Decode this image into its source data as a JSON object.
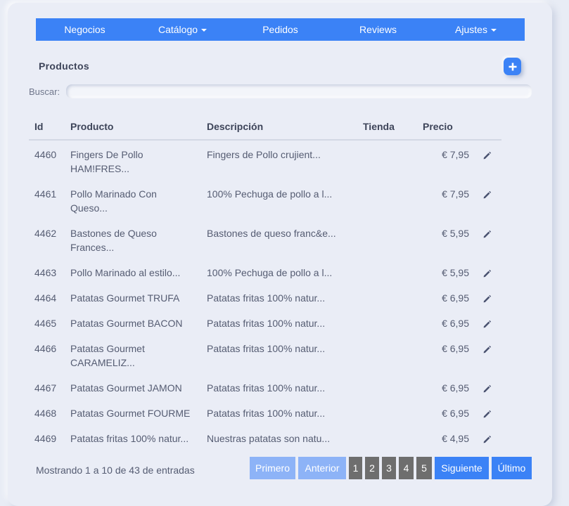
{
  "nav": {
    "items": [
      {
        "label": "Negocios",
        "dropdown": false
      },
      {
        "label": "Catálogo",
        "dropdown": true
      },
      {
        "label": "Pedidos",
        "dropdown": false
      },
      {
        "label": "Reviews",
        "dropdown": false
      },
      {
        "label": "Ajustes",
        "dropdown": true
      }
    ],
    "color": "#3b82f6"
  },
  "page": {
    "title": "Productos",
    "add_icon": "plus-icon"
  },
  "search": {
    "label": "Buscar:",
    "value": ""
  },
  "table": {
    "headers": [
      "Id",
      "Producto",
      "Descripción",
      "Tienda",
      "Precio"
    ],
    "edit_icon": "pencil-icon",
    "rows": [
      {
        "id": "4460",
        "producto": [
          "Fingers De Pollo",
          "HAM!FRES..."
        ],
        "descripcion": "Fingers de Pollo crujient...",
        "tienda": "",
        "precio": "€ 7,95"
      },
      {
        "id": "4461",
        "producto": [
          "Pollo Marinado Con",
          "Queso..."
        ],
        "descripcion": "100% Pechuga de pollo a l...",
        "tienda": "",
        "precio": "€ 7,95"
      },
      {
        "id": "4462",
        "producto": [
          "Bastones de Queso",
          "Frances..."
        ],
        "descripcion": "Bastones de queso franc&e...",
        "tienda": "",
        "precio": "€ 5,95"
      },
      {
        "id": "4463",
        "producto": [
          "Pollo Marinado al estilo..."
        ],
        "descripcion": "100% Pechuga de pollo a l...",
        "tienda": "",
        "precio": "€ 5,95"
      },
      {
        "id": "4464",
        "producto": [
          "Patatas Gourmet TRUFA"
        ],
        "descripcion": "Patatas fritas 100% natur...",
        "tienda": "",
        "precio": "€ 6,95"
      },
      {
        "id": "4465",
        "producto": [
          "Patatas Gourmet BACON"
        ],
        "descripcion": "Patatas fritas 100% natur...",
        "tienda": "",
        "precio": "€ 6,95"
      },
      {
        "id": "4466",
        "producto": [
          "Patatas Gourmet",
          "CARAMELIZ..."
        ],
        "descripcion": "Patatas fritas 100% natur...",
        "tienda": "",
        "precio": "€ 6,95"
      },
      {
        "id": "4467",
        "producto": [
          "Patatas Gourmet JAMON"
        ],
        "descripcion": "Patatas fritas 100% natur...",
        "tienda": "",
        "precio": "€ 6,95"
      },
      {
        "id": "4468",
        "producto": [
          "Patatas Gourmet FOURME"
        ],
        "descripcion": "Patatas fritas 100% natur...",
        "tienda": "",
        "precio": "€ 6,95"
      },
      {
        "id": "4469",
        "producto": [
          "Patatas fritas 100% natur..."
        ],
        "descripcion": "Nuestras patatas son natu...",
        "tienda": "",
        "precio": "€ 4,95"
      }
    ]
  },
  "footer": {
    "info": "Mostrando 1 a 10 de 43 de entradas",
    "pagination": {
      "first": "Primero",
      "prev": "Anterior",
      "pages": [
        "1",
        "2",
        "3",
        "4",
        "5"
      ],
      "next": "Siguiente",
      "last": "Último"
    }
  }
}
